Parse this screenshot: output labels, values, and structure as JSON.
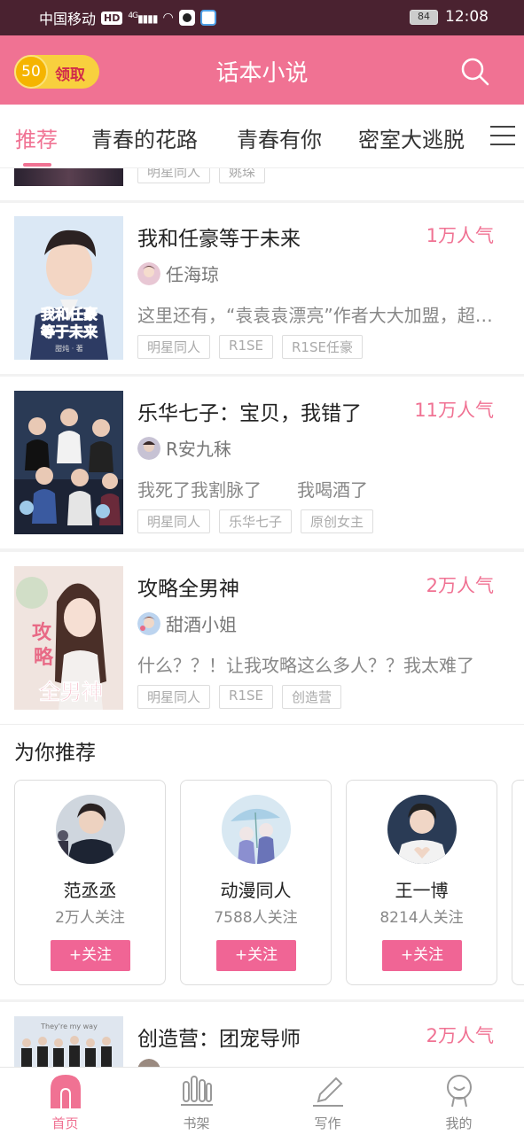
{
  "status_bar": {
    "carrier": "中国移动",
    "hd_badge": "HD",
    "network": "4G",
    "battery": "84",
    "time": "12:08"
  },
  "header": {
    "coin_amount": "50",
    "claim_label": "领取",
    "title": "话本小说",
    "search_icon": "search-icon"
  },
  "tabs": [
    {
      "label": "推荐",
      "active": true
    },
    {
      "label": "青春的花路",
      "active": false
    },
    {
      "label": "青春有你",
      "active": false
    },
    {
      "label": "密室大逃脱",
      "active": false
    }
  ],
  "partial_top": {
    "tags": [
      "明星同人",
      "姚琛"
    ]
  },
  "books": [
    {
      "title": "我和任豪等于未来",
      "popularity": "1万人气",
      "author": "任海琼",
      "description": "这里还有，“袁袁袁漂亮”作者大大加盟，超大型连载…",
      "tags": [
        "明星同人",
        "R1SE",
        "R1SE任豪"
      ],
      "cover_text": "我和任豪等于未来",
      "cover_small": "甜炖 · 著"
    },
    {
      "title": "乐华七子：宝贝，我错了",
      "popularity": "11万人气",
      "author": "R安九秣",
      "description": "我死了我割脉了　　我喝酒了",
      "tags": [
        "明星同人",
        "乐华七子",
        "原创女主"
      ]
    },
    {
      "title": "攻略全男神",
      "popularity": "2万人气",
      "author": "甜酒小姐",
      "description": "什么？？！让我攻略这么多人？？我太难了",
      "tags": [
        "明星同人",
        "R1SE",
        "创造营"
      ],
      "cover_text": "攻略全男神"
    }
  ],
  "recommend": {
    "title": "为你推荐",
    "follow_label": "+关注",
    "cards": [
      {
        "name": "范丞丞",
        "followers": "2万人关注"
      },
      {
        "name": "动漫同人",
        "followers": "7588人关注"
      },
      {
        "name": "王一博",
        "followers": "8214人关注"
      }
    ]
  },
  "partial_bottom": {
    "title": "创造营：团宠导师",
    "popularity": "2万人气",
    "cover_caption": "They're my way"
  },
  "bottom_nav": [
    {
      "label": "首页",
      "icon": "home-icon",
      "active": true
    },
    {
      "label": "书架",
      "icon": "bookshelf-icon",
      "active": false
    },
    {
      "label": "写作",
      "icon": "pen-icon",
      "active": false
    },
    {
      "label": "我的",
      "icon": "profile-icon",
      "active": false
    }
  ],
  "colors": {
    "accent": "#f07293",
    "status_bar": "#4a2230",
    "follow_button": "#f06595"
  }
}
